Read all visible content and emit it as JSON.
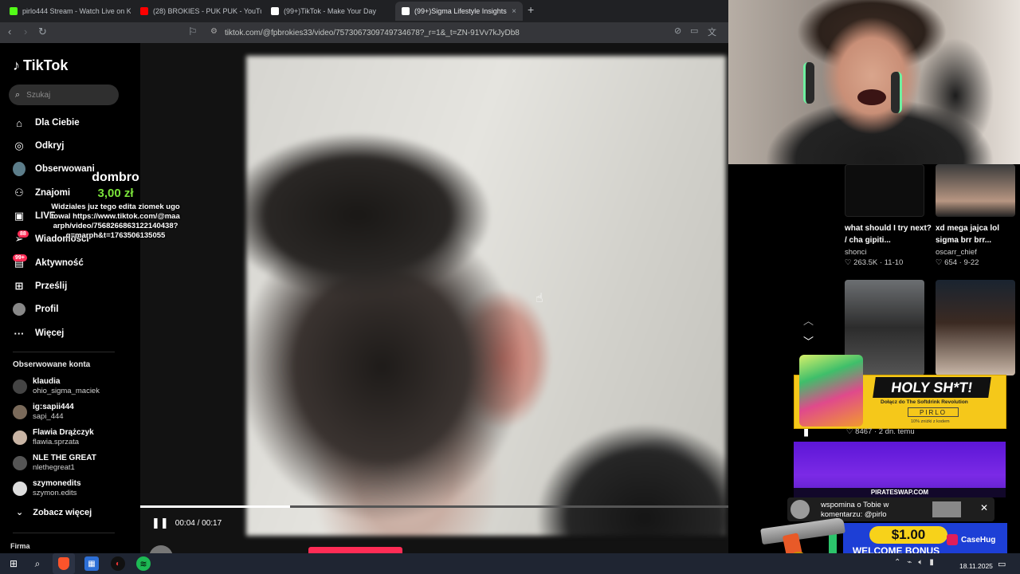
{
  "browser": {
    "tabs": [
      {
        "label": "pirlo444 Stream - Watch Live on Kick",
        "icon": "kick-icon",
        "color": "#53fc18"
      },
      {
        "label": "(28) BROKIES - PUK PUK - YouTube",
        "icon": "youtube-icon",
        "color": "#ff0000"
      },
      {
        "label": "(99+)TikTok - Make Your Day",
        "icon": "tiktok-icon",
        "color": "#ffffff"
      },
      {
        "label": "(99+)Sigma Lifestyle Insights",
        "icon": "tiktok-icon",
        "color": "#ffffff",
        "active": true
      }
    ],
    "url": "tiktok.com/@fpbrokies33/video/7573067309749734678?_r=1&_t=ZN-91Vv7kJyDb8"
  },
  "sidebar": {
    "logo": "TikTok",
    "search_placeholder": "Szukaj",
    "nav": [
      {
        "label": "Dla Ciebie",
        "icon": "home-icon"
      },
      {
        "label": "Odkryj",
        "icon": "compass-icon"
      },
      {
        "label": "Obserwowani",
        "icon": "avatar-icon"
      },
      {
        "label": "Znajomi",
        "icon": "friends-icon"
      },
      {
        "label": "LIVE",
        "icon": "live-icon"
      },
      {
        "label": "Wiadomości",
        "icon": "inbox-icon",
        "badge": "88"
      },
      {
        "label": "Aktywność",
        "icon": "activity-icon",
        "badge": "99+"
      },
      {
        "label": "Prześlij",
        "icon": "upload-icon"
      },
      {
        "label": "Profil",
        "icon": "profile-icon"
      },
      {
        "label": "Więcej",
        "icon": "more-icon"
      }
    ],
    "followed_header": "Obserwowane konta",
    "accounts": [
      {
        "name": "klaudia",
        "handle": "ohio_sigma_maciek"
      },
      {
        "name": "ig:sapii444",
        "handle": "sapi_444"
      },
      {
        "name": "Flawia Drążczyk",
        "handle": "flawia.sprzata"
      },
      {
        "name": "NLE THE GREAT",
        "handle": "nlethegreat1"
      },
      {
        "name": "szymonedits",
        "handle": "szymon.edits"
      }
    ],
    "see_more": "Zobacz więcej",
    "footer": "Firma"
  },
  "donation": {
    "name": "dombro",
    "amount": "3,00 zł",
    "message": "Widziales juz tego edita ziomek ugotowal https://www.tiktok.com/@maaarph/video/7568266863122140438?q=marph&t=1763506135055"
  },
  "player": {
    "time": "00:04 / 00:17",
    "progress": 0.2353,
    "author": "fpbrokies33",
    "likes_partial": "834"
  },
  "related": [
    {
      "title": "what should I try next? / cha gipiti...",
      "user": "shonci",
      "stats": "263.5K · 11-10"
    },
    {
      "title": "xd mega jajca lol sigma brr brr...",
      "user": "oscarr_chief",
      "stats": "654 · 9-22"
    }
  ],
  "overlay": {
    "ad_holy": {
      "headline": "HOLY SH*T!",
      "sub": "Dołącz do The Softdrink Revolution",
      "code": "PIRLO",
      "tiny": "10% zniżki z kodem"
    },
    "like_stat": "8467 · 2 dn. temu",
    "purple_domain": "PIRATESWAP.COM",
    "notif": "wspomina o Tobie w komentarzu: @pirlo",
    "bonus": {
      "amount": "$1.00",
      "label": "WELCOME BONUS",
      "brand": "CaseHug"
    }
  },
  "taskbar": {
    "date": "18.11.2025"
  }
}
